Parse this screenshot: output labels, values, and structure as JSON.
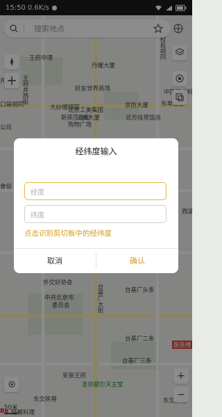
{
  "status": {
    "time": "15:50",
    "speed": "0.6K/s"
  },
  "search": {
    "placeholder": "搜索地点"
  },
  "map_labels": {
    "wangfu": "王府中環",
    "dangan": "丹耀大厦",
    "haoyou": "好友世界商场",
    "gongmei1": "北京工美集团",
    "gongmei2": "工美大厦",
    "jingfang": "京防大厦",
    "beifang": "北方佳苑饭店",
    "dashahu": "大纱帽胡同",
    "xinhua1": "新燕莎金街",
    "xinhua2": "购物广场",
    "zhongguo": "中国医学科",
    "dongtang": "东单三条",
    "waijiao": "外交好协会",
    "zhonggong1": "中共北京市",
    "zhonggong2": "委员会",
    "taiji1": "台基厂头条",
    "taiji2": "台基厂二条",
    "taiji3": "台基厂三条",
    "shengmifu": "圣弥额尔天主堂",
    "dongjiao": "东交民巷",
    "andong": "安泉王府",
    "dongjiaoxiang": "东交民巷",
    "hospital": "医技楼",
    "scale": "50米",
    "corner": "Be",
    "cornerb": "特餐料理",
    "taiji_v": "台基厂大街",
    "wangfujing_v": "王府井西街",
    "left1": "井",
    "left2": "口袋胡同",
    "left3": "公司",
    "left4": "食俗",
    "right_top": "校肩胡同",
    "right2": "西湖酒店",
    "right3": "东单三条"
  },
  "dialog": {
    "title": "经纬度输入",
    "lng_placeholder": "经度",
    "lat_placeholder": "纬度",
    "clipboard_link": "点击识别剪切板中的经纬度",
    "cancel": "取消",
    "confirm": "确认"
  }
}
